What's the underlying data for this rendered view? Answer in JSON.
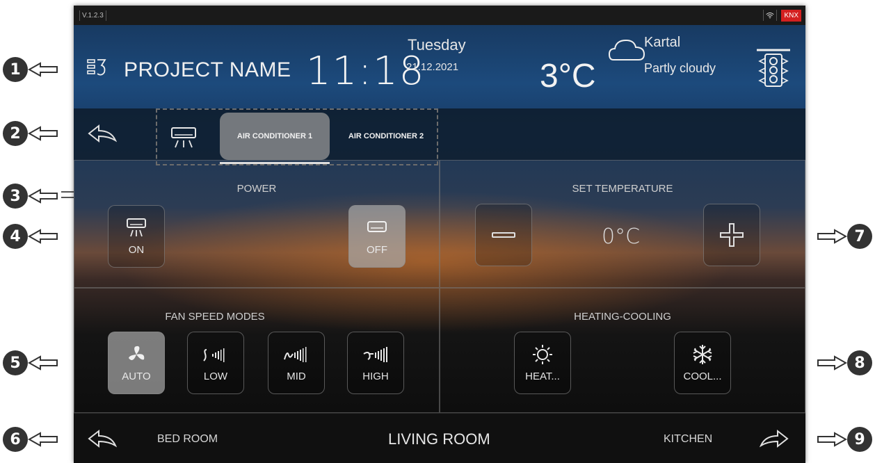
{
  "status": {
    "version": "V.1.2.3",
    "badge": "KNX",
    "badge_color": "#d42020"
  },
  "header": {
    "project_name": "PROJECT NAME",
    "time": "11:18",
    "day": "Tuesday",
    "date": "21.12.2021",
    "outdoor_temp": "3°C",
    "location": "Kartal",
    "condition": "Partly cloudy"
  },
  "tabs": [
    {
      "label": "AIR CONDITIONER 1",
      "active": true
    },
    {
      "label": "AIR CONDITIONER 2",
      "active": false
    }
  ],
  "power": {
    "title": "POWER",
    "on_label": "ON",
    "off_label": "OFF",
    "selected": "OFF"
  },
  "set_temperature": {
    "title": "SET TEMPERATURE",
    "value": "0°C"
  },
  "fan": {
    "title": "FAN SPEED MODES",
    "modes": [
      "AUTO",
      "LOW",
      "MID",
      "HIGH"
    ],
    "selected": "AUTO"
  },
  "heating_cooling": {
    "title": "HEATING-COOLING",
    "heat_label": "HEAT...",
    "cool_label": "COOL..."
  },
  "footer": {
    "prev_room": "BED ROOM",
    "current_room": "LIVING ROOM",
    "next_room": "KITCHEN"
  },
  "callouts": [
    "1",
    "2",
    "3",
    "4",
    "5",
    "6",
    "7",
    "8",
    "9"
  ],
  "icons": {
    "menu": "menu-icon",
    "weather": "cloud-icon",
    "traffic": "traffic-light-icon",
    "ac": "air-conditioner-icon",
    "fan": "fan-icon",
    "sun": "sun-icon",
    "snow": "snowflake-icon"
  }
}
